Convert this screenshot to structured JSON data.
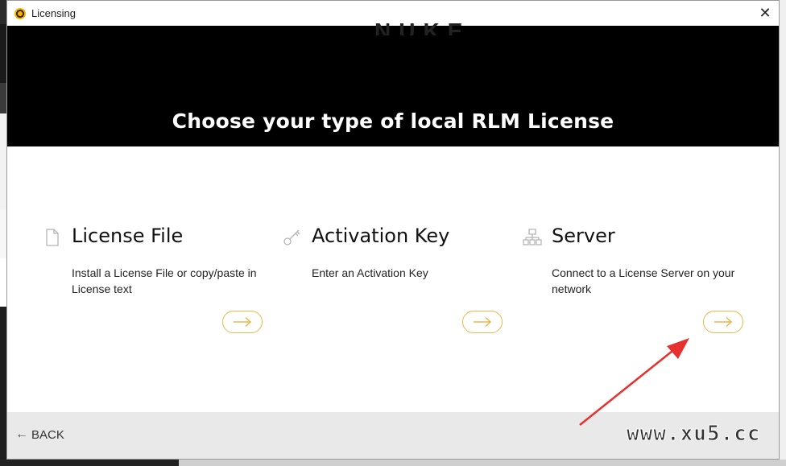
{
  "window": {
    "title": "Licensing",
    "close_symbol": "✕"
  },
  "banner": {
    "ghost_text": "NUKE",
    "title": "Choose your type of local RLM License"
  },
  "options": [
    {
      "title": "License File",
      "description": "Install a License File or copy/paste in License text",
      "icon": "document-icon"
    },
    {
      "title": "Activation Key",
      "description": "Enter an Activation Key",
      "icon": "key-icon"
    },
    {
      "title": "Server",
      "description": "Connect to a License Server on your network",
      "icon": "network-icon"
    }
  ],
  "footer": {
    "back_label": "BACK",
    "back_arrow": "←",
    "watermark": "www.xu5.cc"
  },
  "colors": {
    "accent": "#e8b84a",
    "banner_bg": "#000000",
    "footer_bg": "#e9e9e9",
    "annotation": "#e8302e"
  }
}
